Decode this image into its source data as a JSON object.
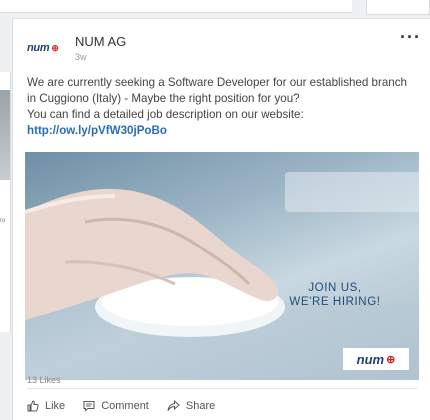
{
  "post": {
    "company": "NUM AG",
    "time": "3w",
    "more_icon": "more-dots-icon",
    "logo": {
      "word": "num",
      "mark": "⊕"
    },
    "text_line1": "We are currently seeking a Software Developer for our established branch",
    "text_line2": "in Cuggiono (Italy) - Maybe the right position for you?",
    "text_line3": "You can find a detailed job description on our website:",
    "link": "http://ow.ly/pVfW30jPoBo"
  },
  "media": {
    "headline_line1": "JOIN US,",
    "headline_line2": "WE'RE HIRING!",
    "badge_word": "num",
    "badge_mark": "⊕"
  },
  "social": {
    "likes": "13 Likes",
    "actions": [
      {
        "label": "Like",
        "icon": "thumbs-up-icon"
      },
      {
        "label": "Comment",
        "icon": "comment-icon"
      },
      {
        "label": "Share",
        "icon": "share-icon"
      }
    ]
  },
  "neighbors": {
    "left_caption": "ro"
  }
}
